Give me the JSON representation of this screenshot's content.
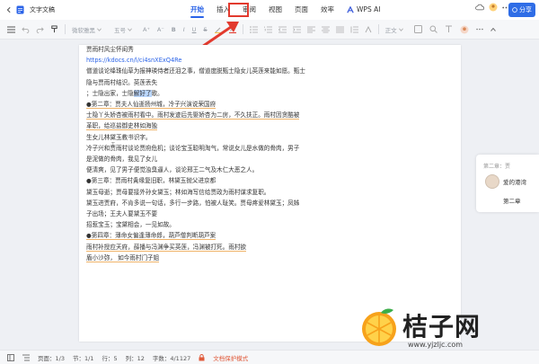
{
  "app": {
    "doc_title": "文字文稿"
  },
  "tabs": [
    {
      "label": "开始",
      "active": true
    },
    {
      "label": "插入",
      "active": false
    },
    {
      "label": "审阅",
      "active": false
    },
    {
      "label": "视图",
      "active": false
    },
    {
      "label": "页面",
      "active": false
    },
    {
      "label": "效率",
      "active": false
    }
  ],
  "wps_ai_label": "WPS AI",
  "share_label": "分享",
  "toolbar": {
    "font_name": "微软雅黑",
    "font_size": "五号",
    "style_label": "正文"
  },
  "document": {
    "lines": [
      {
        "text": "贾雨村风尘怀闺秀",
        "style": "normal"
      },
      {
        "text": "https://kdocs.cn/l/ci4snXExQ4Re",
        "style": "link"
      },
      {
        "text": "僧道谈论绛珠仙草为报神瑛侍者还泪之事，僧道度脱甄士隐女儿英莲来能如愿。甄士",
        "style": "normal"
      },
      {
        "text": "隐与贾雨村结识。英莲丢失",
        "style": "normal"
      },
      {
        "text": "；士隐出家，士隐解好了歌。",
        "style": "normal"
      },
      {
        "text": "●第二章：贾夫人仙逝扬州城，冷子兴演说荣国府",
        "style": "underline"
      },
      {
        "text": "士隐丫头娇杏被雨村看中。雨村发迹后先娶娇杏为二房，不久扶正。雨村因贪酷被",
        "style": "underline"
      },
      {
        "text": "革职，给巡盐御史林如海独",
        "style": "underline"
      },
      {
        "text": "生女儿林黛玉教书识字。",
        "style": "normal"
      },
      {
        "text": "冷子兴和贾雨村谈论贾府危机；谈论宝玉聪明淘气，常说女儿是水做的骨肉，男子",
        "style": "normal"
      },
      {
        "text": "是泥做的骨肉，我见了女儿",
        "style": "normal"
      },
      {
        "text": "便清爽，见了男子便觉浊臭逼人，谈论邢王二气及木仁大恶之人。",
        "style": "normal"
      },
      {
        "text": "●第三章：贾雨村夤缘复旧职，林黛玉抛父进京都",
        "style": "normal"
      },
      {
        "text": "黛玉母逝；贾母要接外孙女黛玉；林如海写信给贾政为雨村谋求复职。",
        "style": "normal"
      },
      {
        "text": "黛玉进贾府，不肯多说一句话，多行一步路，怕被人耻笑。贾母疼爱林黛玉；凤姊",
        "style": "normal"
      },
      {
        "text": "子出场；王夫人要黛玉不要",
        "style": "normal"
      },
      {
        "text": "招惹宝玉；宝黛相会，一见如故。",
        "style": "normal"
      },
      {
        "text": "●第四章：薄命女偏逢薄命郎，葫芦僧判断葫芦案",
        "style": "underline"
      },
      {
        "text": "雨村补授应天府，薛播与冯渊争买英莲，冯渊被打死。雨村欲",
        "style": "underline"
      },
      {
        "text": "盾小沙弥，  如今雨村门子姐",
        "style": "underline"
      }
    ]
  },
  "side_panel": {
    "top_text": "第二章：贾",
    "user_name": "爱的港湾",
    "chapter": "第二章"
  },
  "statusbar": {
    "page": "页面：1/3",
    "section": "节：1/1",
    "row": "行：5",
    "column": "列：12",
    "words": "字数：4/1127",
    "protect": "文档保护模式"
  },
  "watermark": {
    "title": "桔子网",
    "url": "www.yjzljc.com"
  },
  "colors": {
    "accent": "#2a63e8",
    "highlight_red": "#e23a2e",
    "underline": "#f0b46a"
  }
}
